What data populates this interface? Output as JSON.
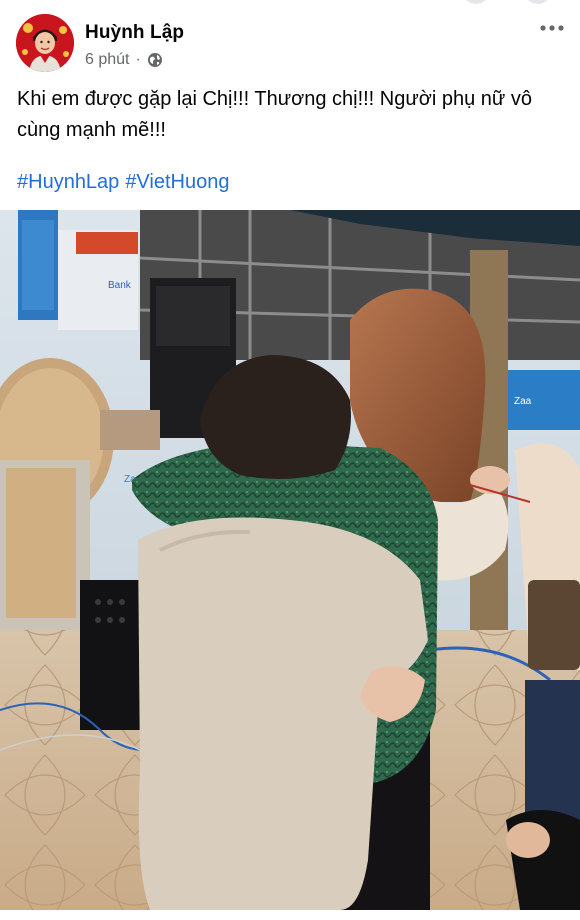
{
  "post": {
    "author": "Huỳnh Lập",
    "time": "6 phút",
    "separator": "·",
    "privacy_icon": "globe-icon",
    "more_icon": "more-horizontal-icon",
    "caption": "Khi em được gặp lại Chị!!! Thương chị!!! Người phụ nữ vô cùng mạnh mẽ!!!",
    "hashtags": [
      "#HuynhLap",
      "#VietHuong"
    ],
    "photo_texts": {
      "bank_sign": "Bank",
      "banner_a": "Za",
      "banner_b": "Zaa"
    }
  },
  "colors": {
    "text_primary": "#050505",
    "text_secondary": "#65676b",
    "hashtag": "#216fdb",
    "avatar_red": "#c8151e",
    "cardigan_green": "#2f6a4d"
  }
}
